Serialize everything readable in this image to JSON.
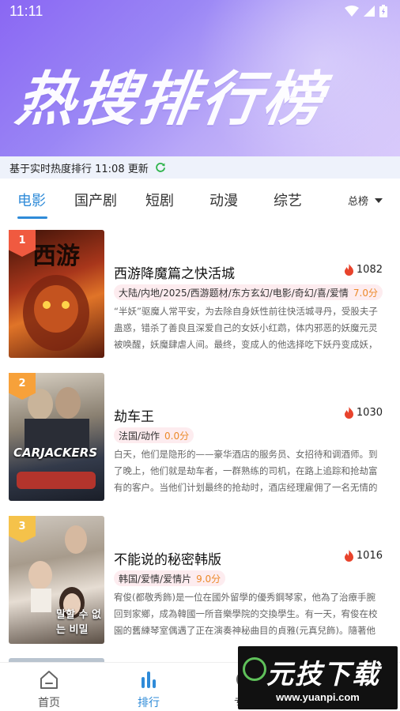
{
  "status_bar": {
    "time": "11:11"
  },
  "hero": {
    "title": "热搜排行榜"
  },
  "update_bar": {
    "text": "基于实时热度排行 11:08 更新"
  },
  "tabs": [
    {
      "label": "电影",
      "active": true
    },
    {
      "label": "国产剧",
      "active": false
    },
    {
      "label": "短剧",
      "active": false
    },
    {
      "label": "动漫",
      "active": false
    },
    {
      "label": "综艺",
      "active": false
    }
  ],
  "sort": {
    "label": "总榜"
  },
  "items": [
    {
      "rank": "1",
      "title": "西游降魔篇之快活城",
      "heat": "1082",
      "tags": "大陆/内地/2025/西游题材/东方玄幻/电影/奇幻/喜/爱情",
      "score": "7.0分",
      "description": "“半妖”驱魔人常平安，为去除自身妖性前往快活城寻丹，受股夫子蛊惑，错杀了善良且深爱自己的女妖小红鹉，体内邪恶的妖魔元灵被唤醒，妖魔肆虐人间。最终，变成人的他选择吃下妖丹变成妖，携手...",
      "poster_text": "西游"
    },
    {
      "rank": "2",
      "title": "劫车王",
      "heat": "1030",
      "tags": "法国/动作",
      "score": "0.0分",
      "description": "白天，他们是隐形的——豪华酒店的服务员、女招待和调酒师。到了晚上，他们就是劫车者，一群熟练的司机，在路上追踪和抢劫富有的客户。当他们计划最终的抢劫时，酒店经理雇佣了一名无情的杀手...",
      "poster_text": "CARJACKERS"
    },
    {
      "rank": "3",
      "title": "不能说的秘密韩版",
      "heat": "1016",
      "tags": "韩国/爱情/爱情片",
      "score": "9.0分",
      "description": "宥俊(都敬秀飾)是一位在國外留學的優秀鋼琴家，他為了治療手腕回到家鄉，成為韓國一所音樂學院的交換學生。有一天，宥俊在校園的舊練琴室偶遇了正在演奏神秘曲目的貞雅(元真兒飾)。隨著他們相...",
      "poster_text": "말할 수 없는 비밀"
    }
  ],
  "bottom_nav": [
    {
      "label": "首页",
      "icon": "home-icon",
      "active": false
    },
    {
      "label": "排行",
      "icon": "ranking-icon",
      "active": true
    },
    {
      "label": "专题",
      "icon": "topic-icon",
      "active": false
    }
  ],
  "watermark": {
    "brand": "元技下载",
    "url": "www.yuanpi.com"
  },
  "colors": {
    "accent": "#2f8bd8",
    "hero_start": "#8a67f3",
    "flame": "#e8432c",
    "score": "#ec8a2a"
  }
}
